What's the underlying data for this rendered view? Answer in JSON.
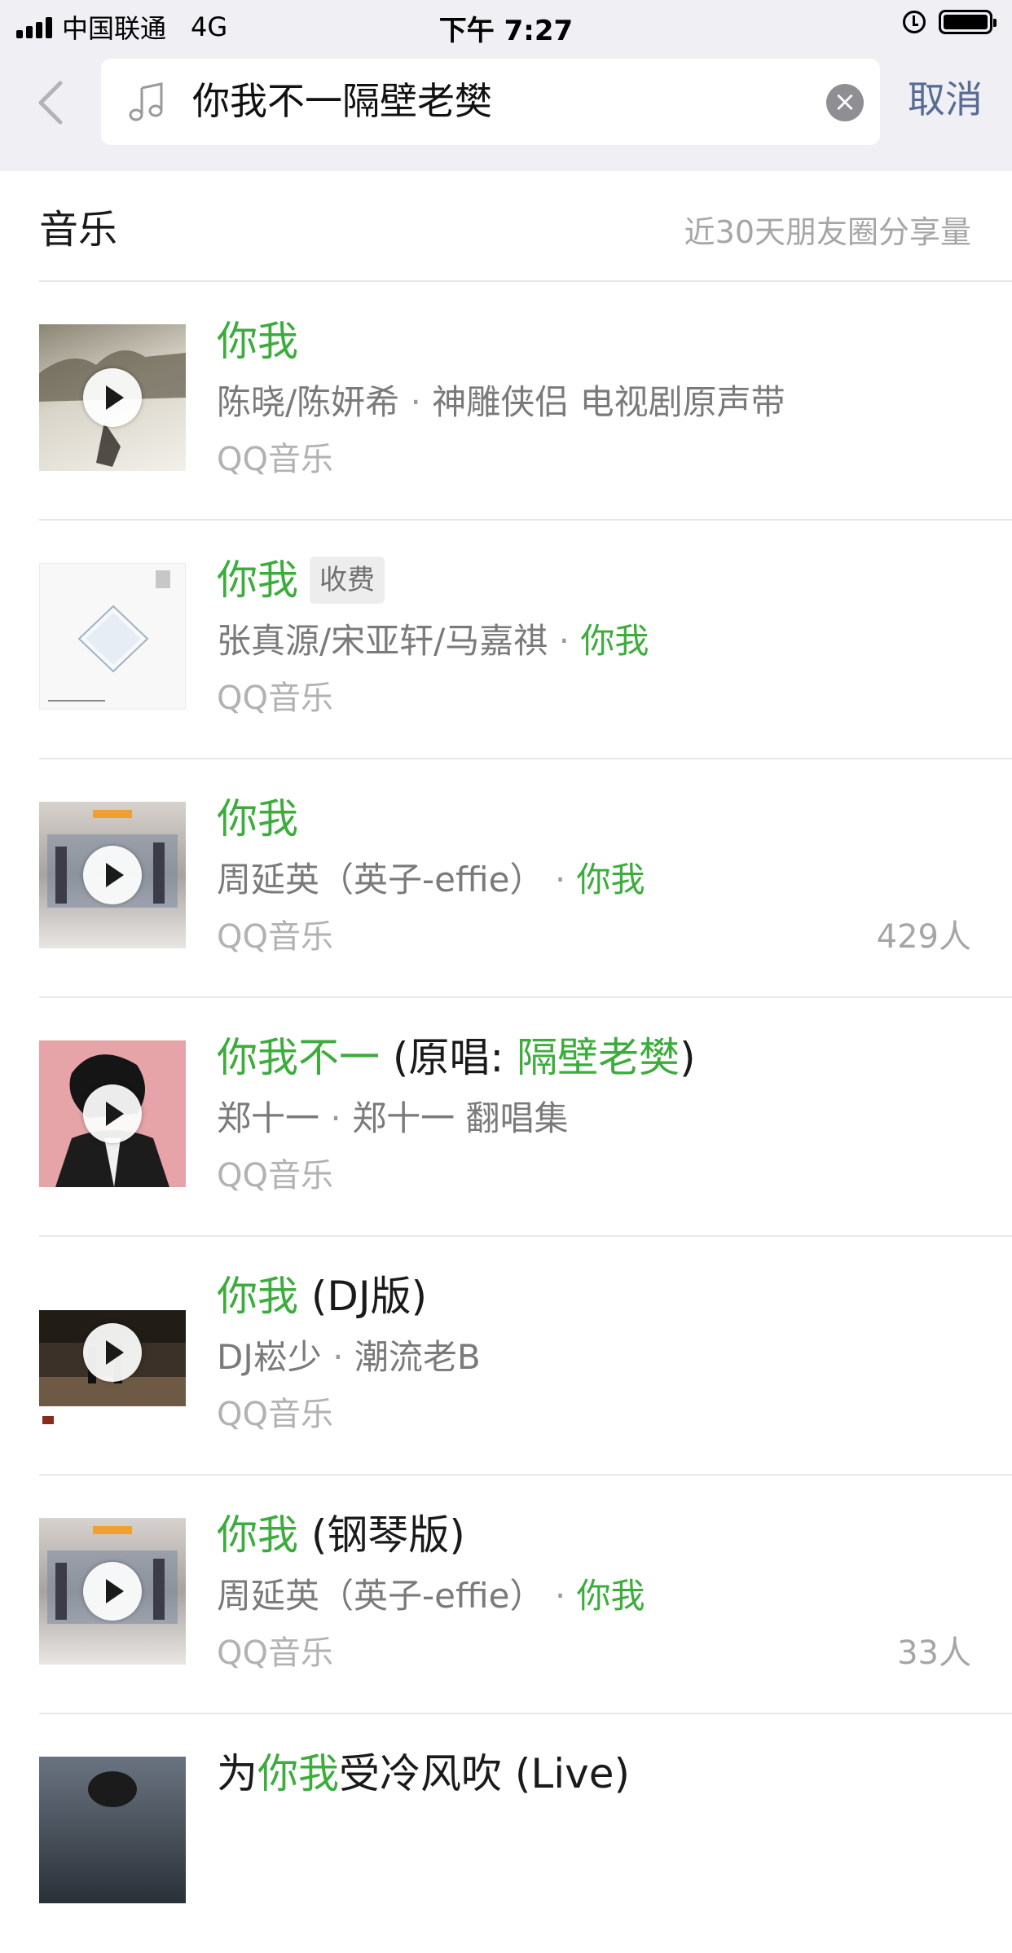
{
  "status_bar": {
    "carrier": "中国联通",
    "network": "4G",
    "time": "下午 7:27"
  },
  "search": {
    "query": "你我不一隔壁老樊",
    "cancel_label": "取消"
  },
  "section": {
    "title": "音乐",
    "meta": "近30天朋友圈分享量"
  },
  "results": [
    {
      "title": "你我",
      "title_suffix": "",
      "artists": "陈晓/陈妍希",
      "separator": "·",
      "album": "神雕侠侣 电视剧原声带",
      "album_highlight": false,
      "source": "QQ音乐",
      "count": "",
      "badge": "",
      "cover_colors": [
        "#6f6a5a",
        "#cfcbc0"
      ]
    },
    {
      "title": "你我",
      "title_suffix": "",
      "artists": "张真源/宋亚轩/马嘉祺",
      "separator": "·",
      "album": "你我",
      "album_highlight": true,
      "source": "QQ音乐",
      "count": "",
      "badge": "收费",
      "cover_colors": [
        "#f7f7f7",
        "#9fb3c8"
      ]
    },
    {
      "title": "你我",
      "title_suffix": "",
      "artists": "周延英（英子-effie）",
      "separator": "·",
      "album": "你我",
      "album_highlight": true,
      "source": "QQ音乐",
      "count": "429人",
      "badge": "",
      "cover_colors": [
        "#c9c3bf",
        "#4b5f7a"
      ]
    },
    {
      "title": "你我不一",
      "title_suffix": " (原唱: ",
      "title_suffix_hl": "隔壁老樊",
      "title_suffix_end": ")",
      "artists": "郑十一",
      "separator": "·",
      "album": "郑十一 翻唱集",
      "album_highlight": false,
      "source": "QQ音乐",
      "count": "",
      "badge": "",
      "cover_colors": [
        "#e3a0a6",
        "#1c1c1c"
      ]
    },
    {
      "title": "你我",
      "title_suffix": " (DJ版)",
      "artists": "DJ崧少",
      "separator": "·",
      "album": "潮流老B",
      "album_highlight": false,
      "source": "QQ音乐",
      "count": "",
      "badge": "",
      "cover_colors": [
        "#3a2f26",
        "#7a6450"
      ]
    },
    {
      "title": "你我",
      "title_suffix": " (钢琴版)",
      "artists": "周延英（英子-effie）",
      "separator": "·",
      "album": "你我",
      "album_highlight": true,
      "source": "QQ音乐",
      "count": "33人",
      "badge": "",
      "cover_colors": [
        "#c9c3bf",
        "#4b5f7a"
      ]
    },
    {
      "title_prefix": "为",
      "title": "你我",
      "title_suffix": "受冷风吹 (Live)",
      "artists": "",
      "separator": "",
      "album": "",
      "album_highlight": false,
      "source": "",
      "count": "",
      "badge": "",
      "cover_colors": [
        "#5a6470",
        "#2a3038"
      ]
    }
  ],
  "colors": {
    "highlight": "#3cac3c",
    "link": "#576b95",
    "header_bg": "#efeff4"
  }
}
